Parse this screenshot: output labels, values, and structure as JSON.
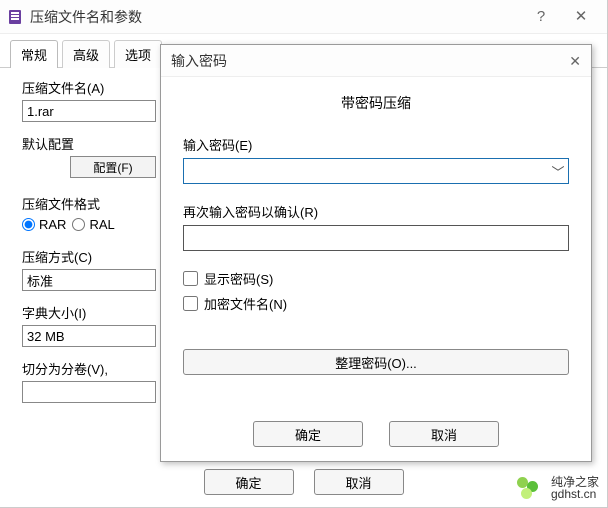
{
  "mainWindow": {
    "title": "压缩文件名和参数",
    "helpBtn": "?",
    "closeBtn": "✕",
    "tabs": {
      "general": "常规",
      "advanced": "高级",
      "options": "选项"
    },
    "fileNameLabel": "压缩文件名(A)",
    "fileNameValue": "1.rar",
    "defaultCfgLabel": "默认配置",
    "cfgBtn": "配置(F)",
    "formatLabel": "压缩文件格式",
    "fmtRar": "RAR",
    "fmtRal": "RAL",
    "methodLabel": "压缩方式(C)",
    "methodValue": "标准",
    "dictLabel": "字典大小(I)",
    "dictValue": "32 MB",
    "splitLabel": "切分为分卷(V),",
    "ok": "确定",
    "cancel": "取消"
  },
  "modal": {
    "title": "输入密码",
    "closeBtn": "✕",
    "heading": "带密码压缩",
    "passLabel": "输入密码(E)",
    "confirmLabel": "再次输入密码以确认(R)",
    "showPass": "显示密码(S)",
    "encryptNames": "加密文件名(N)",
    "orgBtn": "整理密码(O)...",
    "ok": "确定",
    "cancel": "取消"
  },
  "watermark": {
    "line1": "纯净之家",
    "line2": "gdhst.cn"
  }
}
